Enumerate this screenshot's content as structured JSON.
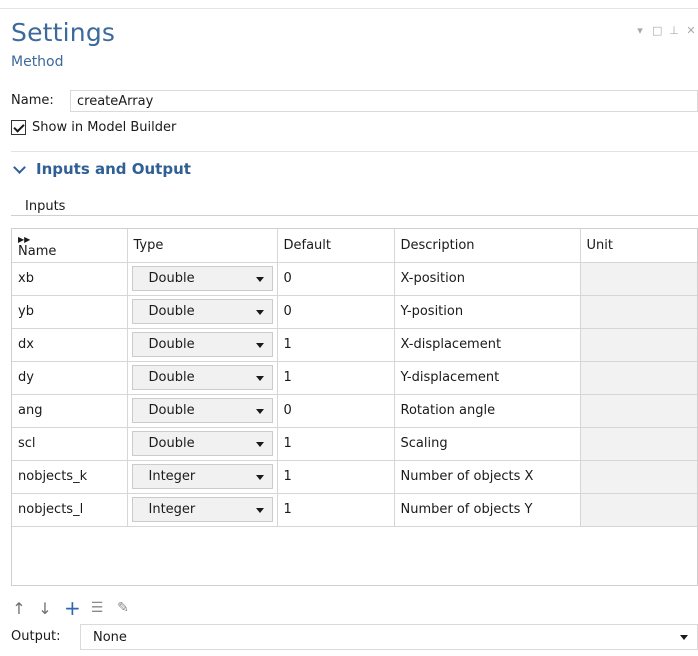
{
  "header": {
    "title": "Settings",
    "subtitle": "Method",
    "window_controls": [
      "chevron-down-icon",
      "maximize-icon",
      "pin-icon",
      "close-icon"
    ]
  },
  "name_field": {
    "label": "Name:",
    "value": "createArray"
  },
  "show_in_model_builder": {
    "label": "Show in Model Builder",
    "checked": true
  },
  "section": {
    "title": "Inputs and Output",
    "expanded": true
  },
  "inputs": {
    "group_label": "Inputs",
    "columns": [
      "Name",
      "Type",
      "Default",
      "Description",
      "Unit"
    ],
    "rows": [
      {
        "name": "xb",
        "type": "Double",
        "default": "0",
        "description": "X-position",
        "unit": ""
      },
      {
        "name": "yb",
        "type": "Double",
        "default": "0",
        "description": "Y-position",
        "unit": ""
      },
      {
        "name": "dx",
        "type": "Double",
        "default": "1",
        "description": "X-displacement",
        "unit": ""
      },
      {
        "name": "dy",
        "type": "Double",
        "default": "1",
        "description": "Y-displacement",
        "unit": ""
      },
      {
        "name": "ang",
        "type": "Double",
        "default": "0",
        "description": "Rotation angle",
        "unit": ""
      },
      {
        "name": "scl",
        "type": "Double",
        "default": "1",
        "description": "Scaling",
        "unit": ""
      },
      {
        "name": "nobjects_k",
        "type": "Integer",
        "default": "1",
        "description": "Number of objects X",
        "unit": ""
      },
      {
        "name": "nobjects_l",
        "type": "Integer",
        "default": "1",
        "description": "Number of objects Y",
        "unit": ""
      }
    ]
  },
  "toolbar": {
    "icons": [
      "move-up-icon",
      "move-down-icon",
      "add-icon",
      "clear-table-icon",
      "edit-icon"
    ]
  },
  "output": {
    "label": "Output:",
    "value": "None"
  }
}
